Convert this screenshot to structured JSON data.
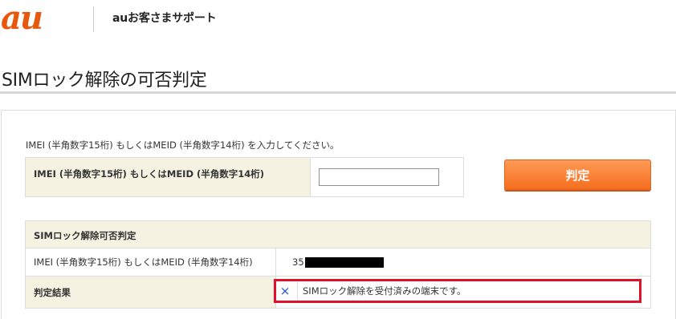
{
  "header": {
    "logo_text": "au",
    "site_prefix": "au",
    "site_title": "お客さまサポート",
    "brand_color": "#e8580c"
  },
  "page": {
    "title": "SIMロック解除の可否判定"
  },
  "form": {
    "instruction": "IMEI (半角数字15桁) もしくはMEID (半角数字14桁) を入力してください。",
    "input_label": "IMEI (半角数字15桁) もしくはMEID (半角数字14桁)",
    "input_value": "",
    "submit_label": "判定"
  },
  "result": {
    "section_title": "SIMロック解除可否判定",
    "imei_row_label": "IMEI (半角数字15桁) もしくはMEID (半角数字14桁)",
    "imei_prefix": "35",
    "result_row_label": "判定結果",
    "result_icon": "x-mark-icon",
    "result_symbol": "×",
    "result_text": "SIMロック解除を受付済みの端末です。",
    "highlight_color": "#e0112b"
  }
}
